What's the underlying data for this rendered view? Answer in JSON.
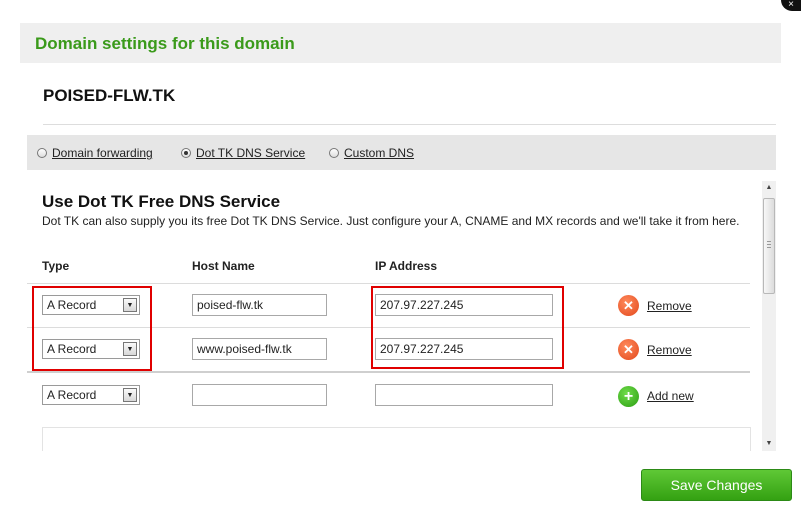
{
  "dialog": {
    "close_glyph": "×",
    "header_title": "Domain settings for this domain",
    "domain_name": "POISED-FLW.TK"
  },
  "options": [
    {
      "label": "Domain forwarding",
      "selected": false
    },
    {
      "label": "Dot TK DNS Service",
      "selected": true
    },
    {
      "label": "Custom DNS",
      "selected": false
    }
  ],
  "dns": {
    "title": "Use Dot TK Free DNS Service",
    "description": "Dot TK can also supply you its free Dot TK DNS Service. Just configure your A, CNAME and MX records and we'll take it from here.",
    "columns": {
      "type": "Type",
      "host": "Host Name",
      "ip": "IP Address"
    },
    "records": [
      {
        "type": "A Record",
        "host": "poised-flw.tk",
        "ip": "207.97.227.245",
        "action": "Remove"
      },
      {
        "type": "A Record",
        "host": "www.poised-flw.tk",
        "ip": "207.97.227.245",
        "action": "Remove"
      }
    ],
    "new_record": {
      "type": "A Record",
      "host": "",
      "ip": "",
      "action": "Add new"
    }
  },
  "footer": {
    "save_label": "Save Changes"
  },
  "colors": {
    "brand_green": "#3a9a1a",
    "highlight_red": "#e00000",
    "remove_orange": "#e2481c",
    "add_green": "#2c9e12"
  }
}
